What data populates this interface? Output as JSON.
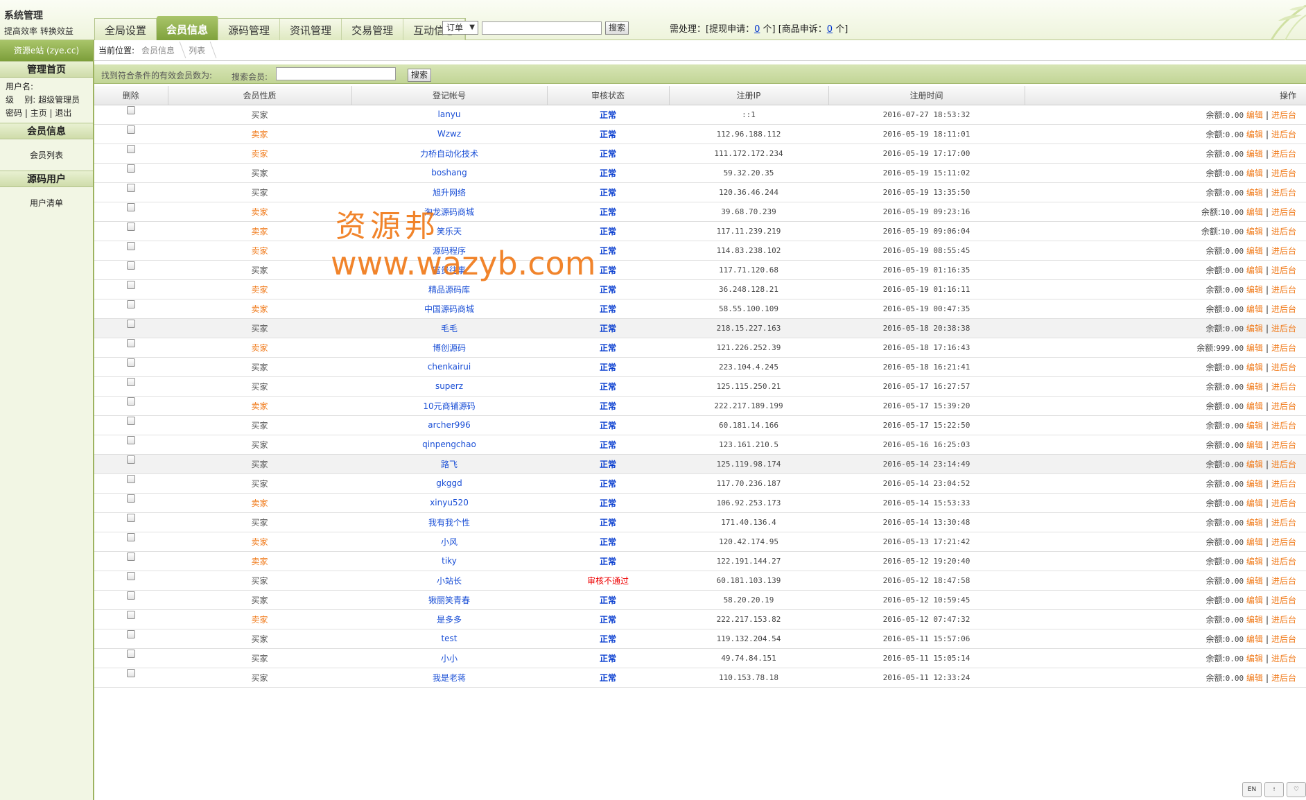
{
  "header": {
    "title": "系统管理",
    "slogan": "提高效率  转换效益",
    "tabs": [
      "全局设置",
      "会员信息",
      "源码管理",
      "资讯管理",
      "交易管理",
      "互动信息"
    ],
    "active_tab": 1,
    "select_value": "订单",
    "search_button": "搜索",
    "pending_prefix": "需处理：[提现申请：",
    "pending_withdraw": "0",
    "pending_mid": " 个] [商品申诉：",
    "pending_complaint": "0",
    "pending_suffix": " 个]"
  },
  "sidebar": {
    "site_link": "资源e站 (zye.cc)",
    "home_heading": "管理首页",
    "user_label": "用户名:",
    "level_label": "级    别:",
    "level_value": "超级管理员",
    "link_password": "密码",
    "link_home": "主页",
    "link_logout": "退出",
    "section_member": "会员信息",
    "item_member_list": "会员列表",
    "section_source_user": "源码用户",
    "item_user_list": "用户清单"
  },
  "breadcrumb": {
    "label": "当前位置:",
    "items": [
      "会员信息",
      "列表"
    ]
  },
  "filter": {
    "count_label": "找到符合条件的有效会员数为:",
    "search_label": "搜索会员:",
    "search_button": "搜索"
  },
  "table": {
    "headers": [
      "删除",
      "会员性质",
      "登记帐号",
      "审核状态",
      "注册IP",
      "注册时间",
      "操作"
    ],
    "balance_label": "余额:",
    "edit_label": "编辑",
    "backend_label": "进后台",
    "rows": [
      {
        "type": "买家",
        "account": "lanyu",
        "status": "正常",
        "ip": "::1",
        "time": "2016-07-27 18:53:32",
        "balance": "0.00"
      },
      {
        "type": "卖家",
        "account": "Wzwz",
        "status": "正常",
        "ip": "112.96.188.112",
        "time": "2016-05-19 18:11:01",
        "balance": "0.00"
      },
      {
        "type": "卖家",
        "account": "力桥自动化技术",
        "status": "正常",
        "ip": "111.172.172.234",
        "time": "2016-05-19 17:17:00",
        "balance": "0.00"
      },
      {
        "type": "买家",
        "account": "boshang",
        "status": "正常",
        "ip": "59.32.20.35",
        "time": "2016-05-19 15:11:02",
        "balance": "0.00"
      },
      {
        "type": "买家",
        "account": "旭升网络",
        "status": "正常",
        "ip": "120.36.46.244",
        "time": "2016-05-19 13:35:50",
        "balance": "0.00"
      },
      {
        "type": "卖家",
        "account": "淘龙源码商城",
        "status": "正常",
        "ip": "39.68.70.239",
        "time": "2016-05-19 09:23:16",
        "balance": "10.00"
      },
      {
        "type": "卖家",
        "account": "笑乐天",
        "status": "正常",
        "ip": "117.11.239.219",
        "time": "2016-05-19 09:06:04",
        "balance": "10.00"
      },
      {
        "type": "卖家",
        "account": "源码程序",
        "status": "正常",
        "ip": "114.83.238.102",
        "time": "2016-05-19 08:55:45",
        "balance": "0.00"
      },
      {
        "type": "买家",
        "account": "富贵往事",
        "status": "正常",
        "ip": "117.71.120.68",
        "time": "2016-05-19 01:16:35",
        "balance": "0.00"
      },
      {
        "type": "卖家",
        "account": "精品源码库",
        "status": "正常",
        "ip": "36.248.128.21",
        "time": "2016-05-19 01:16:11",
        "balance": "0.00"
      },
      {
        "type": "卖家",
        "account": "中国源码商城",
        "status": "正常",
        "ip": "58.55.100.109",
        "time": "2016-05-19 00:47:35",
        "balance": "0.00"
      },
      {
        "type": "买家",
        "account": "毛毛",
        "status": "正常",
        "ip": "218.15.227.163",
        "time": "2016-05-18 20:38:38",
        "balance": "0.00",
        "highlight": true
      },
      {
        "type": "卖家",
        "account": "博创源码",
        "status": "正常",
        "ip": "121.226.252.39",
        "time": "2016-05-18 17:16:43",
        "balance": "999.00"
      },
      {
        "type": "买家",
        "account": "chenkairui",
        "status": "正常",
        "ip": "223.104.4.245",
        "time": "2016-05-18 16:21:41",
        "balance": "0.00"
      },
      {
        "type": "买家",
        "account": "superz",
        "status": "正常",
        "ip": "125.115.250.21",
        "time": "2016-05-17 16:27:57",
        "balance": "0.00"
      },
      {
        "type": "卖家",
        "account": "10元商铺源码",
        "status": "正常",
        "ip": "222.217.189.199",
        "time": "2016-05-17 15:39:20",
        "balance": "0.00"
      },
      {
        "type": "买家",
        "account": "archer996",
        "status": "正常",
        "ip": "60.181.14.166",
        "time": "2016-05-17 15:22:50",
        "balance": "0.00"
      },
      {
        "type": "买家",
        "account": "qinpengchao",
        "status": "正常",
        "ip": "123.161.210.5",
        "time": "2016-05-16 16:25:03",
        "balance": "0.00"
      },
      {
        "type": "买家",
        "account": "路飞",
        "status": "正常",
        "ip": "125.119.98.174",
        "time": "2016-05-14 23:14:49",
        "balance": "0.00",
        "highlight": true
      },
      {
        "type": "买家",
        "account": "gkggd",
        "status": "正常",
        "ip": "117.70.236.187",
        "time": "2016-05-14 23:04:52",
        "balance": "0.00"
      },
      {
        "type": "卖家",
        "account": "xinyu520",
        "status": "正常",
        "ip": "106.92.253.173",
        "time": "2016-05-14 15:53:33",
        "balance": "0.00"
      },
      {
        "type": "买家",
        "account": "我有我个性",
        "status": "正常",
        "ip": "171.40.136.4",
        "time": "2016-05-14 13:30:48",
        "balance": "0.00"
      },
      {
        "type": "卖家",
        "account": "小风",
        "status": "正常",
        "ip": "120.42.174.95",
        "time": "2016-05-13 17:21:42",
        "balance": "0.00"
      },
      {
        "type": "卖家",
        "account": "tiky",
        "status": "正常",
        "ip": "122.191.144.27",
        "time": "2016-05-12 19:20:40",
        "balance": "0.00"
      },
      {
        "type": "买家",
        "account": "小站长",
        "status": "审核不通过",
        "ip": "60.181.103.139",
        "time": "2016-05-12 18:47:58",
        "balance": "0.00"
      },
      {
        "type": "买家",
        "account": "锹丽笑青春",
        "status": "正常",
        "ip": "58.20.20.19",
        "time": "2016-05-12 10:59:45",
        "balance": "0.00"
      },
      {
        "type": "卖家",
        "account": "是多多",
        "status": "正常",
        "ip": "222.217.153.82",
        "time": "2016-05-12 07:47:32",
        "balance": "0.00"
      },
      {
        "type": "买家",
        "account": "test",
        "status": "正常",
        "ip": "119.132.204.54",
        "time": "2016-05-11 15:57:06",
        "balance": "0.00"
      },
      {
        "type": "买家",
        "account": "小小",
        "status": "正常",
        "ip": "49.74.84.151",
        "time": "2016-05-11 15:05:14",
        "balance": "0.00"
      },
      {
        "type": "买家",
        "account": "我是老蒋",
        "status": "正常",
        "ip": "110.153.78.18",
        "time": "2016-05-11 12:33:24",
        "balance": "0.00"
      }
    ]
  },
  "watermark": {
    "line1": "资源邦",
    "line2": "www.wazyb.com"
  },
  "imebar": [
    "EN",
    "⁝",
    "♡"
  ],
  "colors": {
    "accent_green": "#8fb04a",
    "seller_orange": "#f07a1a",
    "link_blue": "#1a4fd6",
    "fail_red": "#ee0000"
  }
}
